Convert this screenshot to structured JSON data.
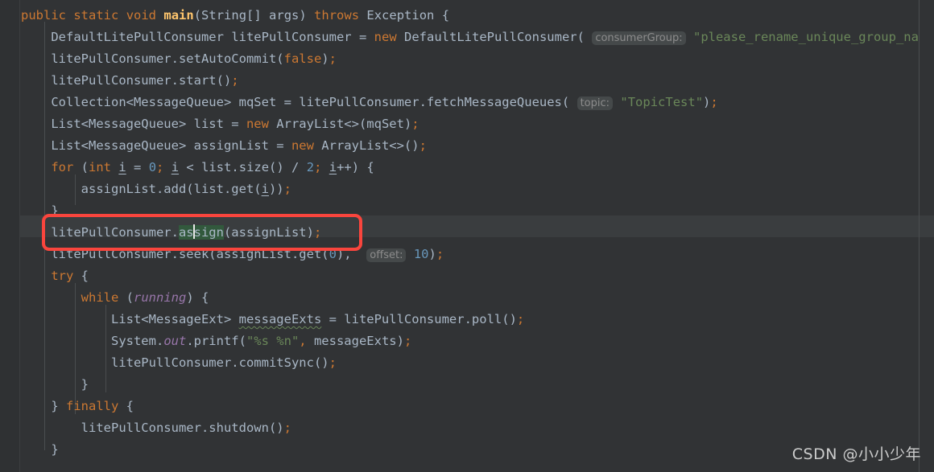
{
  "editor": {
    "language": "java",
    "background": "#313335",
    "foreground": "#a9b7c6",
    "gutter_background": "#2f3133",
    "current_line_background": "#3a3d3f",
    "annotation_color": "#f9453d",
    "selection_highlight_color": "#32593d",
    "keyword_color": "#cc7832",
    "string_color": "#6a8759",
    "number_color": "#6897bb",
    "method_color": "#ffc66d",
    "field_color": "#9876aa",
    "hint_background": "#45494a",
    "hint_color": "#8c8c8c",
    "line_height_px": 27,
    "font_size_px": 15.5
  },
  "code": {
    "lines": [
      {
        "n": 0,
        "text": ""
      },
      {
        "n": 1,
        "text": "public static void main(String[] args) throws Exception {"
      },
      {
        "n": 2,
        "text": "    DefaultLitePullConsumer litePullConsumer = new DefaultLitePullConsumer( consumerGroup: \"please_rename_unique_group_na"
      },
      {
        "n": 3,
        "text": "    litePullConsumer.setAutoCommit(false);"
      },
      {
        "n": 4,
        "text": "    litePullConsumer.start();"
      },
      {
        "n": 5,
        "text": "    Collection<MessageQueue> mqSet = litePullConsumer.fetchMessageQueues( topic: \"TopicTest\");"
      },
      {
        "n": 6,
        "text": "    List<MessageQueue> list = new ArrayList<>(mqSet);"
      },
      {
        "n": 7,
        "text": "    List<MessageQueue> assignList = new ArrayList<>();"
      },
      {
        "n": 8,
        "text": "    for (int i = 0; i < list.size() / 2; i++) {"
      },
      {
        "n": 9,
        "text": "        assignList.add(list.get(i));"
      },
      {
        "n": 10,
        "text": "    }"
      },
      {
        "n": 11,
        "text": "    litePullConsumer.assign(assignList);"
      },
      {
        "n": 12,
        "text": "    litePullConsumer.seek(assignList.get(0),  offset: 10);"
      },
      {
        "n": 13,
        "text": "    try {"
      },
      {
        "n": 14,
        "text": "        while (running) {"
      },
      {
        "n": 15,
        "text": "            List<MessageExt> messageExts = litePullConsumer.poll();"
      },
      {
        "n": 16,
        "text": "            System.out.printf(\"%s %n\", messageExts);"
      },
      {
        "n": 17,
        "text": "            litePullConsumer.commitSync();"
      },
      {
        "n": 18,
        "text": "        }"
      },
      {
        "n": 19,
        "text": "    } finally {"
      },
      {
        "n": 20,
        "text": "        litePullConsumer.shutdown();"
      },
      {
        "n": 21,
        "text": "    }"
      }
    ],
    "parameter_hints": [
      {
        "label": "consumerGroup:",
        "on_line": 2
      },
      {
        "label": "topic:",
        "on_line": 5
      },
      {
        "label": "offset:",
        "on_line": 12
      }
    ],
    "highlighted_token": "assign",
    "caret_line": 11,
    "caret_offset_in_token": 2,
    "annotated_line_text": "litePullConsumer.assign(assignList);",
    "warning_token": "messageExts"
  },
  "tokens": {
    "l1": {
      "public": "public",
      "static": "static",
      "void": "void",
      "main": "main",
      "open": "(",
      "String": "String[]",
      "args": "args",
      "close": ")",
      "throws": "throws",
      "Exception": "Exception",
      "brace": "{"
    },
    "l2": {
      "type": "DefaultLitePullConsumer",
      "var": "litePullConsumer",
      "eq": "=",
      "new": "new",
      "ctor": "DefaultLitePullConsumer(",
      "hint": "consumerGroup:",
      "str": "\"please_rename_unique_group_na"
    },
    "l3": {
      "a": "litePullConsumer.setAutoCommit(",
      "kw": "false",
      "b": ")",
      "semi": ";"
    },
    "l4": {
      "a": "litePullConsumer.start()",
      "semi": ";"
    },
    "l5": {
      "a": "Collection<MessageQueue> mqSet = litePullConsumer.fetchMessageQueues(",
      "hint": "topic:",
      "str": "\"TopicTest\"",
      "b": ")",
      "semi": ";"
    },
    "l6": {
      "a": "List<MessageQueue> list = ",
      "new": "new",
      "b": " ArrayList<>(mqSet)",
      "semi": ";"
    },
    "l7": {
      "a": "List<MessageQueue> assignList = ",
      "new": "new",
      "b": " ArrayList<>()",
      "semi": ";"
    },
    "l8": {
      "for": "for",
      "p1": "(",
      "int": "int",
      "i1": "i",
      "eq": " = ",
      "zero": "0",
      "s1": ";",
      "i2": "i",
      "lt": " < list.size() / ",
      "two": "2",
      "s2": ";",
      "i3": "i",
      "tail": "++) {"
    },
    "l9": {
      "a": "assignList.add(list.get(",
      "i": "i",
      "b": "))",
      "semi": ";"
    },
    "l10": {
      "a": "}"
    },
    "l11": {
      "a": "litePullConsumer.",
      "hl": "assign",
      "b": "(assignList)",
      "semi": ";"
    },
    "l12": {
      "a": "litePullConsumer.seek(assignList.get(",
      "zero": "0",
      "b": "),",
      "hint": "offset:",
      "num": "10",
      "c": ")",
      "semi": ";"
    },
    "l13": {
      "try": "try",
      "brace": " {"
    },
    "l14": {
      "while": "while",
      "p1": " (",
      "running": "running",
      "p2": ") {"
    },
    "l15": {
      "a": "List<MessageExt> ",
      "warn": "messageExts",
      "b": " = litePullConsumer.poll()",
      "semi": ";"
    },
    "l16": {
      "a": "System.",
      "out": "out",
      "b": ".printf(",
      "str": "\"%s %n\"",
      "comma": ",",
      "c": " messageExts)",
      "semi": ";"
    },
    "l17": {
      "a": "litePullConsumer.commitSync()",
      "semi": ";"
    },
    "l18": {
      "a": "}"
    },
    "l19": {
      "a": "} ",
      "finally": "finally",
      "b": " {"
    },
    "l20": {
      "a": "litePullConsumer.shutdown()",
      "semi": ";"
    },
    "l21": {
      "a": "}"
    }
  },
  "watermark": {
    "text": "CSDN @小小少年"
  }
}
